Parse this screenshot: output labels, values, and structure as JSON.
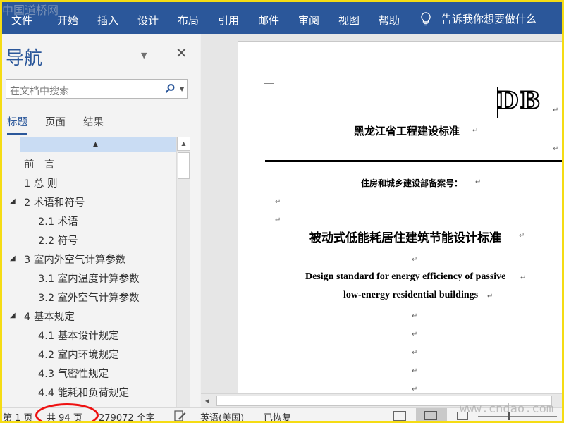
{
  "watermark_top": "中国道桥网",
  "watermark_bottom": "www.cndao.com",
  "ribbon": {
    "tabs": [
      "文件",
      "开始",
      "插入",
      "设计",
      "布局",
      "引用",
      "邮件",
      "审阅",
      "视图",
      "帮助"
    ],
    "tell_me": "告诉我你想要做什么"
  },
  "nav": {
    "title": "导航",
    "search_placeholder": "在文档中搜索",
    "tabs": [
      "标题",
      "页面",
      "结果"
    ],
    "outline": [
      {
        "label": "前　言",
        "level": 1,
        "expandable": false
      },
      {
        "label": "1 总  则",
        "level": 1,
        "expandable": false
      },
      {
        "label": "2 术语和符号",
        "level": 1,
        "expandable": true
      },
      {
        "label": "2.1 术语",
        "level": 2,
        "expandable": false
      },
      {
        "label": "2.2 符号",
        "level": 2,
        "expandable": false
      },
      {
        "label": "3 室内外空气计算参数",
        "level": 1,
        "expandable": true
      },
      {
        "label": "3.1 室内温度计算参数",
        "level": 2,
        "expandable": false
      },
      {
        "label": "3.2 室外空气计算参数",
        "level": 2,
        "expandable": false
      },
      {
        "label": "4 基本规定",
        "level": 1,
        "expandable": true
      },
      {
        "label": "4.1 基本设计规定",
        "level": 2,
        "expandable": false
      },
      {
        "label": "4.2 室内环境规定",
        "level": 2,
        "expandable": false
      },
      {
        "label": "4.3 气密性规定",
        "level": 2,
        "expandable": false
      },
      {
        "label": "4.4 能耗和负荷规定",
        "level": 2,
        "expandable": false
      }
    ]
  },
  "document": {
    "logo": "DB",
    "title_province": "黑龙江省工程建设标准",
    "filing": "住房和城乡建设部备案号：",
    "title_main": "被动式低能耗居住建筑节能设计标准",
    "title_en_1": "Design standard for energy efficiency of passive",
    "title_en_2": "low-energy residential buildings"
  },
  "status": {
    "page": "第 1 页",
    "total": "共 94 页",
    "words": "279072 个字",
    "language": "英语(美国)",
    "recovered": "已恢复"
  }
}
